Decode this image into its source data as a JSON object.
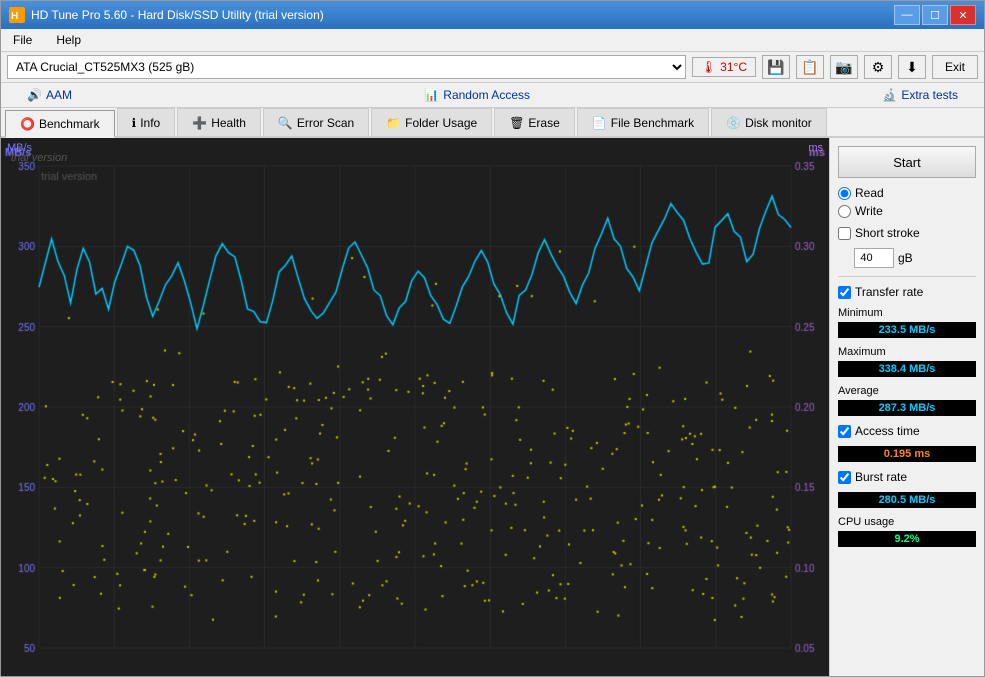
{
  "window": {
    "title": "HD Tune Pro 5.60 - Hard Disk/SSD Utility (trial version)"
  },
  "title_buttons": {
    "minimize": "—",
    "maximize": "☐",
    "close": "✕"
  },
  "menu": {
    "file": "File",
    "help": "Help"
  },
  "toolbar": {
    "disk_value": "ATA     Crucial_CT525MX3 (525 gB)",
    "temperature": "31°C",
    "exit_label": "Exit"
  },
  "sub_toolbar": {
    "aam": "AAM",
    "random_access": "Random Access",
    "extra_tests": "Extra tests"
  },
  "tabs": [
    {
      "id": "benchmark",
      "label": "Benchmark",
      "active": true
    },
    {
      "id": "info",
      "label": "Info",
      "active": false
    },
    {
      "id": "health",
      "label": "Health",
      "active": false
    },
    {
      "id": "error-scan",
      "label": "Error Scan",
      "active": false
    },
    {
      "id": "folder-usage",
      "label": "Folder Usage",
      "active": false
    },
    {
      "id": "erase",
      "label": "Erase",
      "active": false
    },
    {
      "id": "file-benchmark",
      "label": "File Benchmark",
      "active": false
    },
    {
      "id": "disk-monitor",
      "label": "Disk monitor",
      "active": false
    }
  ],
  "chart": {
    "watermark": "trial version",
    "y_axis_left_label": "MB/s",
    "y_axis_right_label": "ms",
    "y_left_values": [
      "350",
      "300",
      "250",
      "200",
      "150",
      "100",
      "50"
    ],
    "y_right_values": [
      "0.35",
      "0.30",
      "0.25",
      "0.20",
      "0.15",
      "0.10",
      "0.05"
    ]
  },
  "right_panel": {
    "start_label": "Start",
    "read_label": "Read",
    "write_label": "Write",
    "short_stroke_label": "Short stroke",
    "stroke_value": "40",
    "stroke_unit": "gB",
    "transfer_rate_label": "Transfer rate",
    "minimum_label": "Minimum",
    "minimum_value": "233.5 MB/s",
    "maximum_label": "Maximum",
    "maximum_value": "338.4 MB/s",
    "average_label": "Average",
    "average_value": "287.3 MB/s",
    "access_time_label": "Access time",
    "access_time_value": "0.195 ms",
    "burst_rate_label": "Burst rate",
    "burst_rate_value": "280.5 MB/s",
    "cpu_usage_label": "CPU usage",
    "cpu_usage_value": "9.2%"
  }
}
